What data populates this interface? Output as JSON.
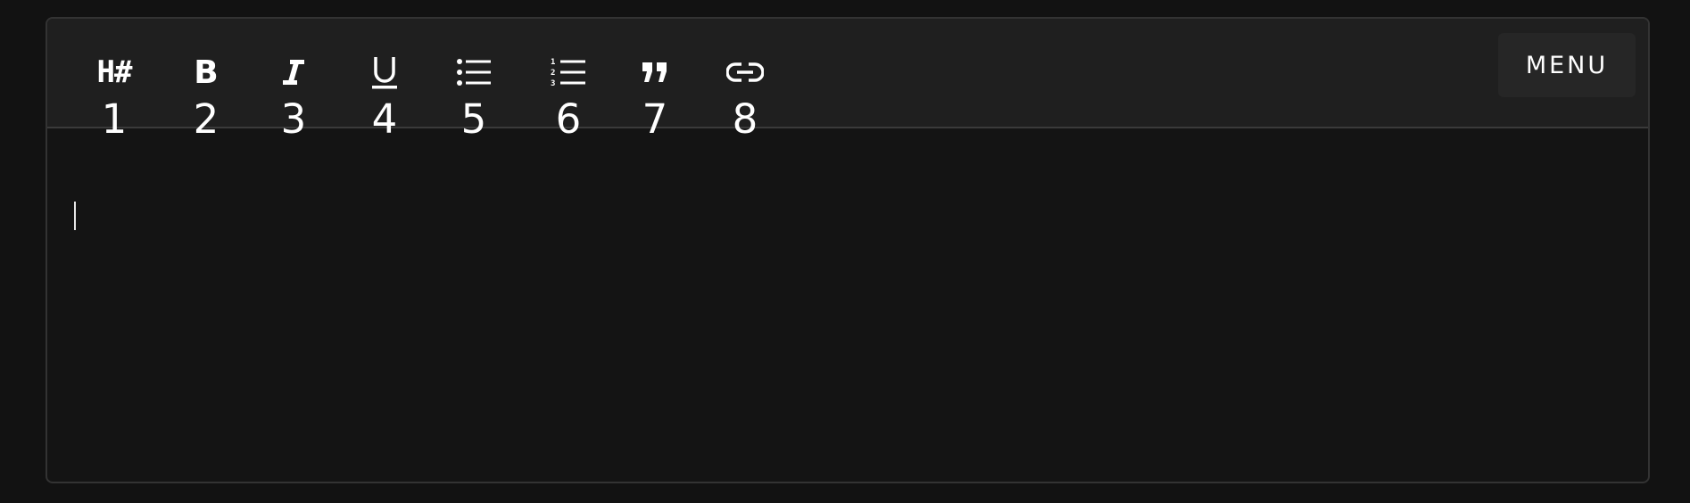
{
  "toolbar": {
    "tools": [
      {
        "icon": "heading-icon",
        "glyph": "H#",
        "shortcut": "1"
      },
      {
        "icon": "bold-icon",
        "glyph": "B",
        "shortcut": "2"
      },
      {
        "icon": "italic-icon",
        "shortcut": "3"
      },
      {
        "icon": "underline-icon",
        "shortcut": "4"
      },
      {
        "icon": "bullet-list-icon",
        "shortcut": "5"
      },
      {
        "icon": "numbered-list-icon",
        "shortcut": "6"
      },
      {
        "icon": "quote-icon",
        "shortcut": "7"
      },
      {
        "icon": "link-icon",
        "shortcut": "8"
      }
    ],
    "menu_label": "MENU"
  },
  "editor": {
    "content": ""
  },
  "colors": {
    "page_background": "#121212",
    "toolbar_background": "#1f1f1f",
    "editor_background": "#141414",
    "foreground": "#ffffff"
  }
}
